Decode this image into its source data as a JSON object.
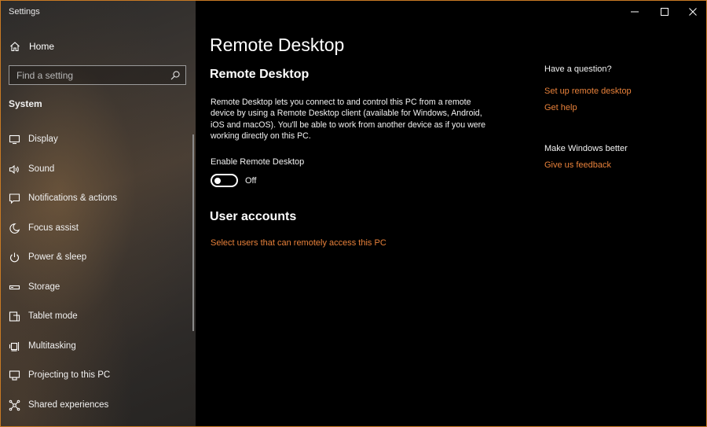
{
  "window": {
    "title": "Settings"
  },
  "sidebar": {
    "home_label": "Home",
    "search_placeholder": "Find a setting",
    "section_label": "System",
    "items": [
      {
        "label": "Display",
        "icon": "display-icon"
      },
      {
        "label": "Sound",
        "icon": "sound-icon"
      },
      {
        "label": "Notifications & actions",
        "icon": "notifications-icon"
      },
      {
        "label": "Focus assist",
        "icon": "focus-assist-icon"
      },
      {
        "label": "Power & sleep",
        "icon": "power-icon"
      },
      {
        "label": "Storage",
        "icon": "storage-icon"
      },
      {
        "label": "Tablet mode",
        "icon": "tablet-mode-icon"
      },
      {
        "label": "Multitasking",
        "icon": "multitasking-icon"
      },
      {
        "label": "Projecting to this PC",
        "icon": "projecting-icon"
      },
      {
        "label": "Shared experiences",
        "icon": "shared-experiences-icon"
      }
    ]
  },
  "main": {
    "page_title": "Remote Desktop",
    "subtitle": "Remote Desktop",
    "description": "Remote Desktop lets you connect to and control this PC from a remote device by using a Remote Desktop client (available for Windows, Android, iOS and macOS). You'll be able to work from another device as if you were working directly on this PC.",
    "toggle_label": "Enable Remote Desktop",
    "toggle_state": "Off",
    "toggle_on": false,
    "user_accounts_title": "User accounts",
    "user_accounts_link": "Select users that can remotely access this PC"
  },
  "help": {
    "heading": "Have a question?",
    "link_setup": "Set up remote desktop",
    "link_help": "Get help",
    "better_heading": "Make Windows better",
    "link_feedback": "Give us feedback"
  },
  "colors": {
    "accent_link": "#e8813a",
    "window_border": "#c87a24"
  }
}
